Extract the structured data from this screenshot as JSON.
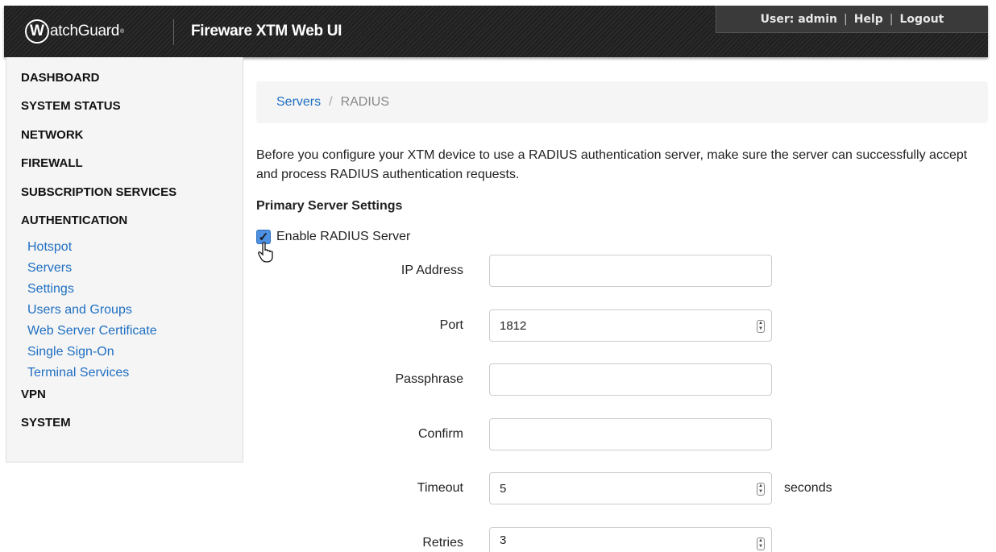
{
  "header": {
    "logo_letter": "W",
    "logo_text": "atchGuard",
    "logo_mark": "®",
    "app_title": "Fireware XTM Web UI",
    "user_label": "User: admin",
    "help_label": "Help",
    "logout_label": "Logout",
    "separator": "|"
  },
  "sidebar": {
    "items": [
      {
        "label": "DASHBOARD"
      },
      {
        "label": "SYSTEM STATUS"
      },
      {
        "label": "NETWORK"
      },
      {
        "label": "FIREWALL"
      },
      {
        "label": "SUBSCRIPTION SERVICES"
      },
      {
        "label": "AUTHENTICATION"
      },
      {
        "label": "VPN"
      },
      {
        "label": "SYSTEM"
      }
    ],
    "auth_subitems": [
      {
        "label": "Hotspot"
      },
      {
        "label": "Servers"
      },
      {
        "label": "Settings"
      },
      {
        "label": "Users and Groups"
      },
      {
        "label": "Web Server Certificate"
      },
      {
        "label": "Single Sign-On"
      },
      {
        "label": "Terminal Services"
      }
    ]
  },
  "breadcrumb": {
    "parent": "Servers",
    "separator": "/",
    "current": "RADIUS"
  },
  "main": {
    "intro": "Before you configure your XTM device to use a RADIUS authentication server, make sure the server can successfully accept and process RADIUS authentication requests.",
    "section_title": "Primary Server Settings",
    "enable_label": "Enable RADIUS Server",
    "enable_checked": true,
    "fields": {
      "ip_address": {
        "label": "IP Address",
        "value": ""
      },
      "port": {
        "label": "Port",
        "value": "1812"
      },
      "passphrase": {
        "label": "Passphrase",
        "value": ""
      },
      "confirm": {
        "label": "Confirm",
        "value": ""
      },
      "timeout": {
        "label": "Timeout",
        "value": "5",
        "suffix": "seconds"
      },
      "retries": {
        "label": "Retries",
        "value": "3"
      }
    }
  },
  "colors": {
    "link": "#1f6fc2",
    "header_bg": "#242424",
    "checkbox": "#4d8fe0"
  }
}
